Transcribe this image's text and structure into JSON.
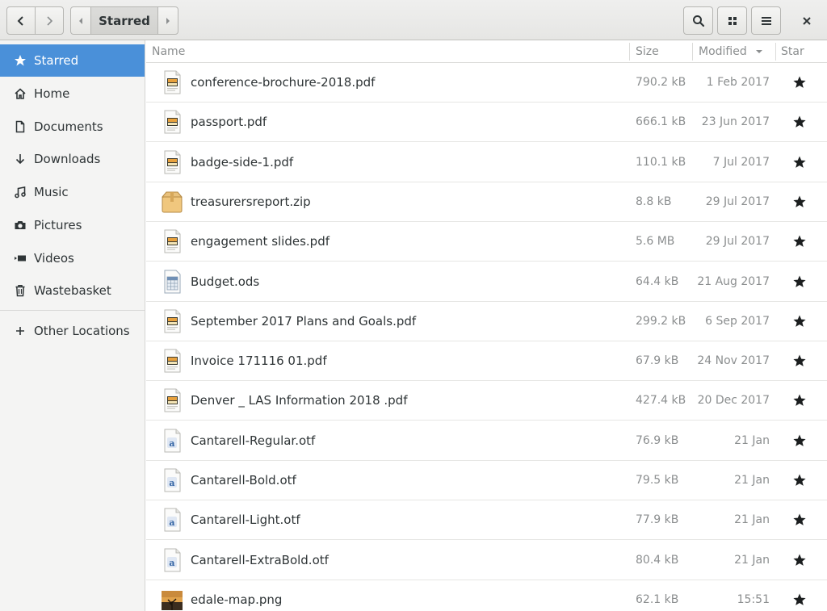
{
  "header": {
    "path_current": "Starred"
  },
  "sidebar": {
    "items": [
      {
        "label": "Starred",
        "icon": "star-icon",
        "active": true
      },
      {
        "label": "Home",
        "icon": "home-icon"
      },
      {
        "label": "Documents",
        "icon": "document-icon"
      },
      {
        "label": "Downloads",
        "icon": "download-icon"
      },
      {
        "label": "Music",
        "icon": "music-icon"
      },
      {
        "label": "Pictures",
        "icon": "camera-icon"
      },
      {
        "label": "Videos",
        "icon": "video-icon"
      },
      {
        "label": "Wastebasket",
        "icon": "trash-icon"
      },
      {
        "label": "Other Locations",
        "icon": "plus-icon"
      }
    ]
  },
  "columns": {
    "name": "Name",
    "size": "Size",
    "modified": "Modified",
    "star": "Star"
  },
  "files": [
    {
      "name": "conference-brochure-2018.pdf",
      "size": "790.2 kB",
      "modified": "1 Feb 2017",
      "type": "pdf"
    },
    {
      "name": "passport.pdf",
      "size": "666.1 kB",
      "modified": "23 Jun 2017",
      "type": "pdf"
    },
    {
      "name": "badge-side-1.pdf",
      "size": "110.1 kB",
      "modified": "7 Jul 2017",
      "type": "pdf"
    },
    {
      "name": "treasurersreport.zip",
      "size": "8.8 kB",
      "modified": "29 Jul 2017",
      "type": "zip"
    },
    {
      "name": "engagement slides.pdf",
      "size": "5.6 MB",
      "modified": "29 Jul 2017",
      "type": "pdf"
    },
    {
      "name": "Budget.ods",
      "size": "64.4 kB",
      "modified": "21 Aug 2017",
      "type": "ods"
    },
    {
      "name": "September 2017 Plans and Goals.pdf",
      "size": "299.2 kB",
      "modified": "6 Sep 2017",
      "type": "pdf"
    },
    {
      "name": "Invoice 171116  01.pdf",
      "size": "67.9 kB",
      "modified": "24 Nov 2017",
      "type": "pdf"
    },
    {
      "name": "Denver _ LAS Information 2018 .pdf",
      "size": "427.4 kB",
      "modified": "20 Dec 2017",
      "type": "pdf"
    },
    {
      "name": "Cantarell-Regular.otf",
      "size": "76.9 kB",
      "modified": "21 Jan",
      "type": "font"
    },
    {
      "name": "Cantarell-Bold.otf",
      "size": "79.5 kB",
      "modified": "21 Jan",
      "type": "font"
    },
    {
      "name": "Cantarell-Light.otf",
      "size": "77.9 kB",
      "modified": "21 Jan",
      "type": "font"
    },
    {
      "name": "Cantarell-ExtraBold.otf",
      "size": "80.4 kB",
      "modified": "21 Jan",
      "type": "font"
    },
    {
      "name": "edale-map.png",
      "size": "62.1 kB",
      "modified": "15:51",
      "type": "image"
    }
  ],
  "colors": {
    "accent": "#4a90d9",
    "sidebar_bg": "#f4f4f3",
    "header_bg": "#e8e8e7",
    "muted_text": "#8b8e8f"
  }
}
